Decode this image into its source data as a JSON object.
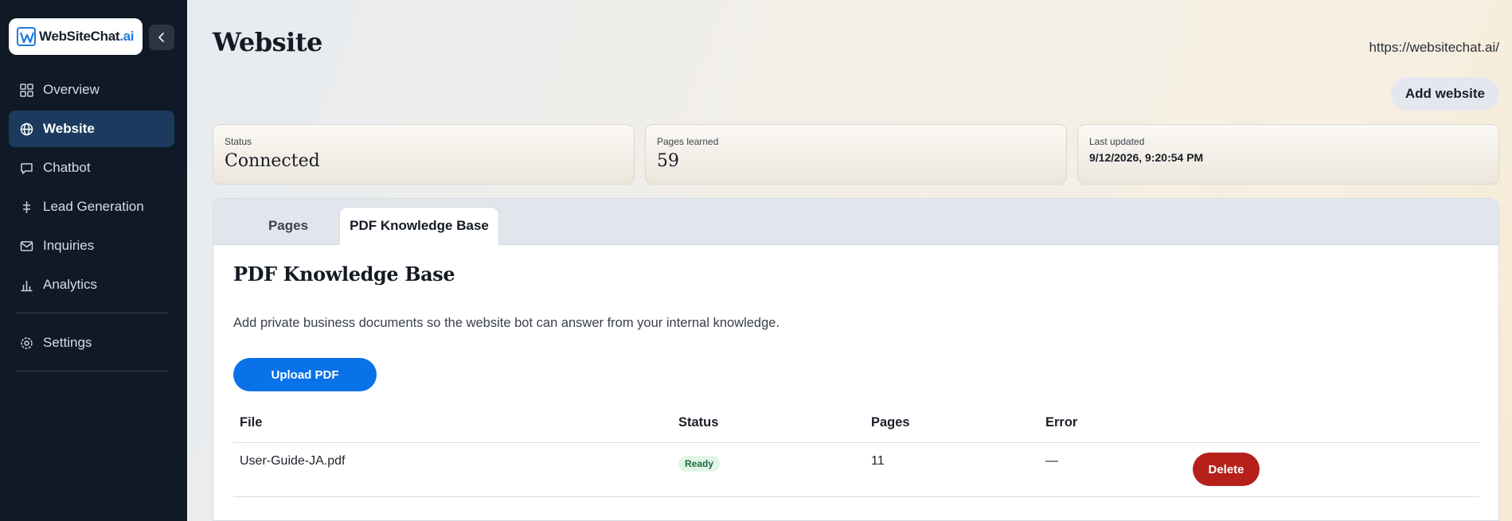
{
  "brand": {
    "name_main": "WebSiteChat",
    "name_suffix": ".ai",
    "accent": "#1e7ae0"
  },
  "sidebar": {
    "items": [
      {
        "label": "Overview",
        "icon": "grid-icon",
        "active": false
      },
      {
        "label": "Website",
        "icon": "globe-icon",
        "active": true
      },
      {
        "label": "Chatbot",
        "icon": "chat-bubble-icon",
        "active": false
      },
      {
        "label": "Lead Generation",
        "icon": "funnel-icon",
        "active": false
      },
      {
        "label": "Inquiries",
        "icon": "mail-icon",
        "active": false
      },
      {
        "label": "Analytics",
        "icon": "bar-chart-icon",
        "active": false
      },
      {
        "label": "Settings",
        "icon": "gear-icon",
        "active": false
      }
    ]
  },
  "header": {
    "title": "Website",
    "site_url": "https://websitechat.ai/",
    "add_website_label": "Add website"
  },
  "stats": {
    "status": {
      "label": "Status",
      "value": "Connected"
    },
    "pages_learned": {
      "label": "Pages learned",
      "value": "59"
    },
    "last_updated": {
      "label": "Last updated",
      "value": "9/12/2026, 9:20:54 PM"
    }
  },
  "tabs": [
    {
      "label": "Pages",
      "active": false
    },
    {
      "label": "PDF Knowledge Base",
      "active": true
    }
  ],
  "pdf_section": {
    "title": "PDF Knowledge Base",
    "description": "Add private business documents so the website bot can answer from your internal knowledge.",
    "upload_label": "Upload PDF",
    "table": {
      "columns": [
        "File",
        "Status",
        "Pages",
        "Error"
      ],
      "rows": [
        {
          "file": "User-Guide-JA.pdf",
          "status": "Ready",
          "pages": "11",
          "error": "—",
          "action": "Delete"
        }
      ]
    }
  },
  "colors": {
    "sidebar_bg": "#0f1a26",
    "active_nav_bg": "#1b3a5e",
    "primary_button": "#0a72e8",
    "danger_button": "#b5201b",
    "ready_badge_bg": "#e2f3e8",
    "ready_badge_text": "#1e6b3c"
  }
}
